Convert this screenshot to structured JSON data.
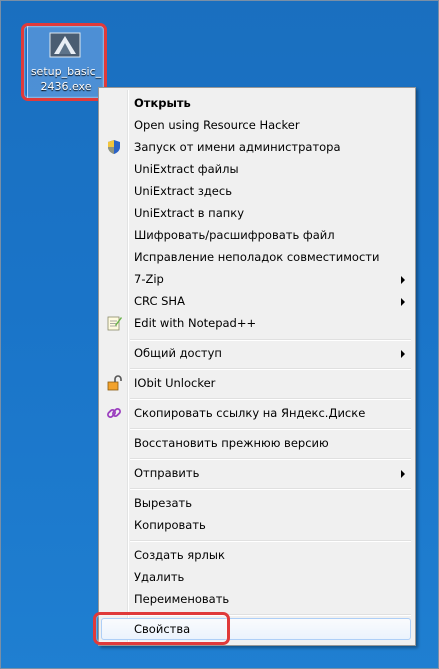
{
  "desktop_icon": {
    "label": "setup_basic_2436.exe"
  },
  "context_menu": {
    "items": [
      {
        "label": "Открыть",
        "bold": true
      },
      {
        "label": "Open using Resource Hacker"
      },
      {
        "label": "Запуск от имени администратора",
        "icon": "uac-shield-icon"
      },
      {
        "label": "UniExtract файлы"
      },
      {
        "label": "UniExtract здесь"
      },
      {
        "label": "UniExtract в папку"
      },
      {
        "label": "Шифровать/расшифровать файл"
      },
      {
        "label": "Исправление неполадок совместимости"
      },
      {
        "label": "7-Zip",
        "submenu": true
      },
      {
        "label": "CRC SHA",
        "submenu": true
      },
      {
        "label": "Edit with Notepad++",
        "icon": "notepad-plus-plus-icon"
      },
      {
        "label": "Общий доступ",
        "submenu": true
      },
      {
        "label": "IObit Unlocker",
        "icon": "unlock-icon"
      },
      {
        "label": "Скопировать ссылку на Яндекс.Диске",
        "icon": "link-icon"
      },
      {
        "label": "Восстановить прежнюю версию"
      },
      {
        "label": "Отправить",
        "submenu": true
      },
      {
        "label": "Вырезать"
      },
      {
        "label": "Копировать"
      },
      {
        "label": "Создать ярлык"
      },
      {
        "label": "Удалить"
      },
      {
        "label": "Переименовать"
      },
      {
        "label": "Свойства",
        "highlighted": true
      }
    ]
  },
  "colors": {
    "desktop": "#1a74c8",
    "highlight_box": "#e03a3a",
    "menu_bg": "#f0f0f0"
  }
}
